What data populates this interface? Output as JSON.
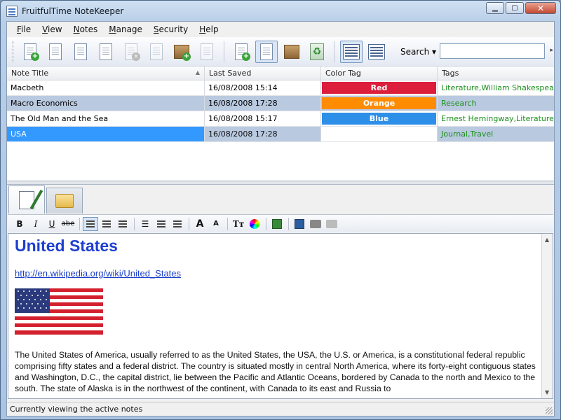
{
  "window": {
    "title": "FruitfulTime NoteKeeper",
    "buttons": {
      "minimize": "▁",
      "maximize": "▢",
      "close": "✕"
    }
  },
  "menu": [
    {
      "label": "File",
      "accel": "F",
      "rest": "ile"
    },
    {
      "label": "View",
      "accel": "V",
      "rest": "iew"
    },
    {
      "label": "Notes",
      "accel": "N",
      "rest": "otes"
    },
    {
      "label": "Manage",
      "accel": "M",
      "rest": "anage"
    },
    {
      "label": "Security",
      "accel": "S",
      "rest": "ecurity"
    },
    {
      "label": "Help",
      "accel": "H",
      "rest": "elp"
    }
  ],
  "toolbar": {
    "search_label": "Search ▾",
    "search_value": "",
    "overflow": "▸"
  },
  "grid": {
    "columns": [
      "Note Title",
      "Last Saved",
      "Color Tag",
      "Tags"
    ],
    "sort_indicator": "▲",
    "rows": [
      {
        "title": "Macbeth",
        "saved": "16/08/2008 15:14",
        "color_label": "Red",
        "color_hex": "#dc1e3c",
        "tags": "Literature,William Shakespeare"
      },
      {
        "title": "Macro Economics",
        "saved": "16/08/2008 17:28",
        "color_label": "Orange",
        "color_hex": "#ff8c00",
        "tags": "Research"
      },
      {
        "title": "The Old Man and the Sea",
        "saved": "16/08/2008 15:17",
        "color_label": "Blue",
        "color_hex": "#2e8fe8",
        "tags": "Ernest Hemingway,Literature"
      },
      {
        "title": "USA",
        "saved": "16/08/2008 17:28",
        "color_label": "",
        "color_hex": "#ffffff",
        "tags": "Journal,Travel"
      }
    ]
  },
  "format_toolbar": {
    "bold": "B",
    "italic": "I",
    "underline": "U",
    "strike": "abe",
    "bullets": "☰",
    "grow_font": "A",
    "shrink_font": "A",
    "font": "Tт"
  },
  "document": {
    "title": "United States",
    "link": "http://en.wikipedia.org/wiki/United_States",
    "body": "The United States of America, usually referred to as the United States, the USA, the U.S. or America, is a constitutional federal republic comprising fifty states and a federal district. The country is situated mostly in central North America, where its forty-eight contiguous states and Washington, D.C., the capital district, lie between the Pacific and Atlantic Oceans, bordered by Canada to the north and Mexico to the south. The state of Alaska is in the northwest of the continent, with Canada to its east and Russia to"
  },
  "status": "Currently viewing the active notes",
  "colors": {
    "selection": "#3399ff",
    "alt_row": "#b9c9e0",
    "title_blue": "#1f3fd1"
  }
}
